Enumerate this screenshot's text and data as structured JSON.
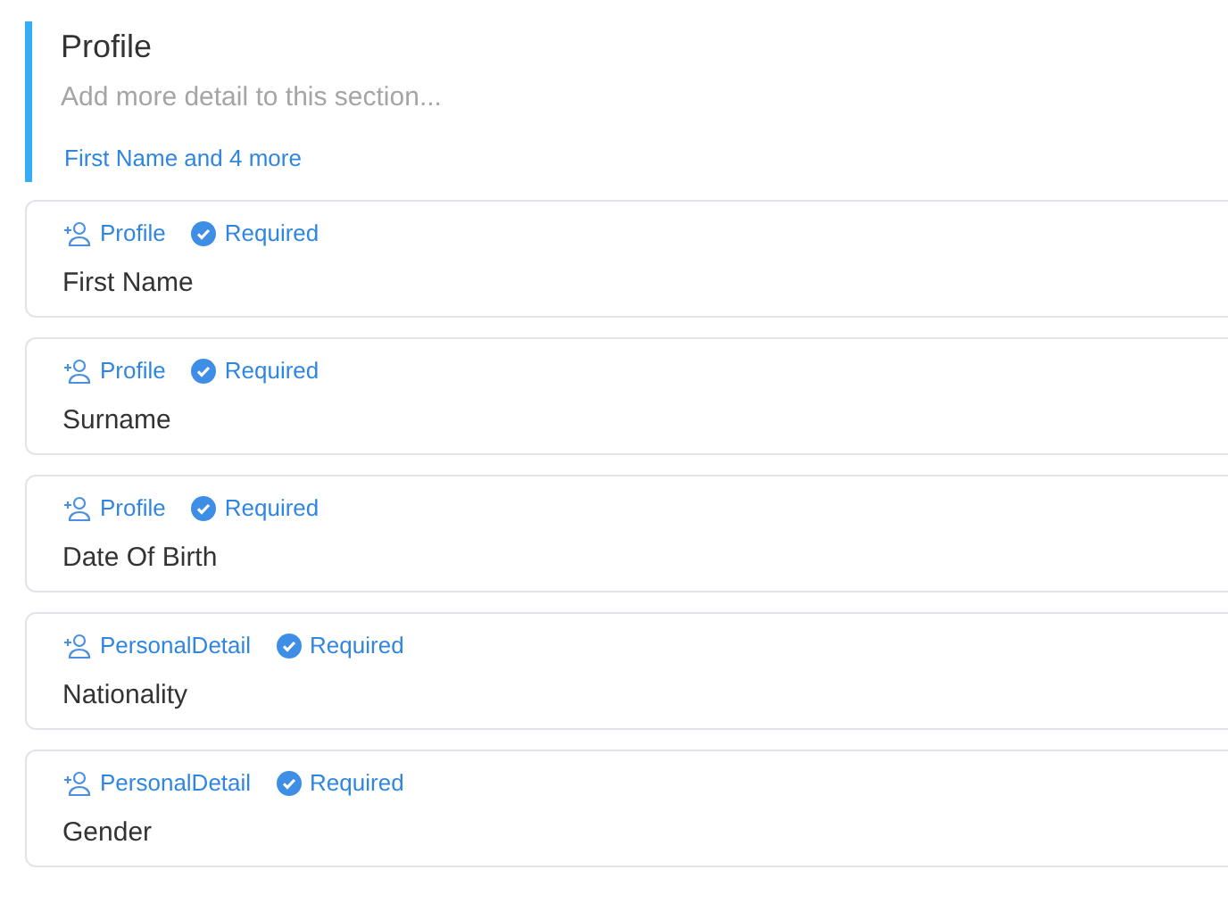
{
  "section": {
    "title": "Profile",
    "placeholder": "Add more detail to this section...",
    "summary": "First Name and 4 more"
  },
  "fields": [
    {
      "source": "Profile",
      "required": true,
      "required_label": "Required",
      "name": "First Name"
    },
    {
      "source": "Profile",
      "required": true,
      "required_label": "Required",
      "name": "Surname"
    },
    {
      "source": "Profile",
      "required": true,
      "required_label": "Required",
      "name": "Date Of Birth"
    },
    {
      "source": "PersonalDetail",
      "required": true,
      "required_label": "Required",
      "name": "Nationality"
    },
    {
      "source": "PersonalDetail",
      "required": true,
      "required_label": "Required",
      "name": "Gender"
    }
  ]
}
